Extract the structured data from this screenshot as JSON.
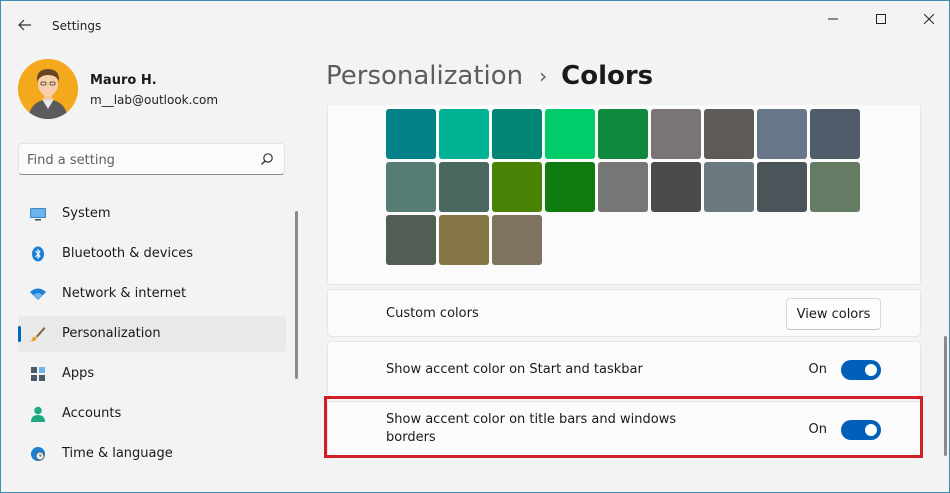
{
  "app": {
    "title": "Settings"
  },
  "user": {
    "name": "Mauro H.",
    "email": "m__lab@outlook.com"
  },
  "search": {
    "placeholder": "Find a setting"
  },
  "sidebar": {
    "items": [
      {
        "label": "System",
        "icon": "monitor-icon",
        "active": false
      },
      {
        "label": "Bluetooth & devices",
        "icon": "bluetooth-icon",
        "active": false
      },
      {
        "label": "Network & internet",
        "icon": "wifi-icon",
        "active": false
      },
      {
        "label": "Personalization",
        "icon": "brush-icon",
        "active": true
      },
      {
        "label": "Apps",
        "icon": "apps-icon",
        "active": false
      },
      {
        "label": "Accounts",
        "icon": "person-icon",
        "active": false
      },
      {
        "label": "Time & language",
        "icon": "clock-globe-icon",
        "active": false
      }
    ]
  },
  "breadcrumb": {
    "parent": "Personalization",
    "separator": "›",
    "current": "Colors"
  },
  "accent_swatches": [
    [
      "#038387",
      "#00b294",
      "#018574",
      "#00cc6a",
      "#10893e",
      "#7a7574",
      "#5d5a58",
      "#68768a",
      "#515c6b"
    ],
    [
      "#567c73",
      "#486860",
      "#498205",
      "#107c10",
      "#767676",
      "#4c4a48",
      "#69797e",
      "#4a5459",
      "#647c64"
    ],
    [
      "#525e54",
      "#847545",
      "#7e735f"
    ]
  ],
  "custom_colors": {
    "label": "Custom colors",
    "button": "View colors"
  },
  "settings": {
    "start_taskbar": {
      "label": "Show accent color on Start and taskbar",
      "state": "On"
    },
    "title_bars": {
      "label_line1": "Show accent color on title bars and windows",
      "label_line2": "borders",
      "state": "On"
    }
  },
  "colors": {
    "accent": "#005fb8",
    "highlight": "#d21f26"
  }
}
